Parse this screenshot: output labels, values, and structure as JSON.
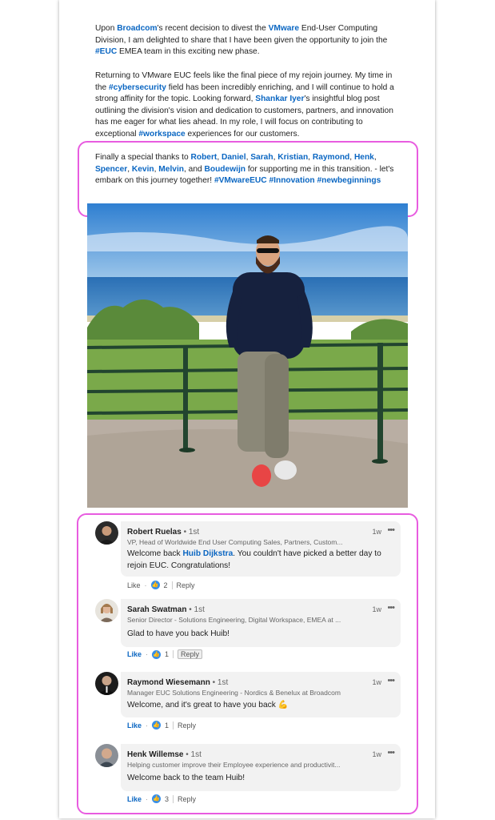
{
  "post": {
    "p1": [
      "Upon ",
      "Broadcom",
      "'s recent decision to divest the ",
      "VMware",
      " End-User Computing Division, I am delighted to share that I have been given the opportunity to join the ",
      "#EUC",
      " EMEA team in this exciting new phase."
    ],
    "p2": [
      "Returning to VMware EUC feels like the final piece of my rejoin journey. My time in the ",
      "#cybersecurity",
      " field has been incredibly enriching, and I will continue to hold a strong affinity for the topic. Looking forward, ",
      "Shankar Iyer",
      "'s insightful blog post outlining the division's vision and dedication to customers, partners, and innovation has me eager for what lies ahead. In my role, I will focus on contributing to exceptional ",
      "#workspace",
      " experiences for our customers."
    ],
    "p3": [
      "Finally a special thanks to ",
      "Robert",
      ", ",
      "Daniel",
      ", ",
      "Sarah",
      ", ",
      "Kristian",
      ", ",
      "Raymond",
      ", ",
      "Henk",
      ", ",
      "Spencer",
      ", ",
      "Kevin",
      ", ",
      "Melvin",
      ", and ",
      "Boudewijn",
      " for supporting me in this transition. - let's embark on this journey together! ",
      "#VMwareEUC",
      " ",
      "#Innovation",
      " ",
      "#newbeginnings"
    ]
  },
  "comments": [
    {
      "name": "Robert Ruelas",
      "degree": " • 1st",
      "title": "VP, Head of Worldwide End User Computing Sales, Partners, Custom...",
      "time": "1w",
      "menu": "•••",
      "text": [
        "Welcome back ",
        "Huib Dijkstra",
        ". You couldn't have picked a better day to rejoin EUC. Congratulations!"
      ],
      "like": "Like",
      "dot": "·",
      "count": "2",
      "reply": "Reply"
    },
    {
      "name": "Sarah Swatman",
      "degree": " • 1st",
      "title": "Senior Director - Solutions Engineering, Digital Workspace, EMEA at ...",
      "time": "1w",
      "menu": "•••",
      "text": [
        "Glad to have you back Huib!"
      ],
      "like": "Like",
      "dot": "·",
      "count": "1",
      "reply": "Reply"
    },
    {
      "name": "Raymond Wiesemann",
      "degree": " • 1st",
      "title": "Manager EUC Solutions Engineering - Nordics & Benelux at Broadcom",
      "time": "1w",
      "menu": "•••",
      "text": [
        "Welcome, and it's great to have you back 💪"
      ],
      "like": "Like",
      "dot": "·",
      "count": "1",
      "reply": "Reply"
    },
    {
      "name": "Henk Willemse",
      "degree": " • 1st",
      "title": "Helping customer improve their Employee experience and productivit...",
      "time": "1w",
      "menu": "•••",
      "text": [
        "Welcome back to the team Huib!"
      ],
      "like": "Like",
      "dot": "·",
      "count": "3",
      "reply": "Reply"
    }
  ],
  "colors": {
    "link": "#0a66c2",
    "highlight": "#e85ce0",
    "reaction": "#378fe9"
  },
  "icons": {
    "reaction": "thumbs-up-icon",
    "menu": "more-options-icon"
  }
}
